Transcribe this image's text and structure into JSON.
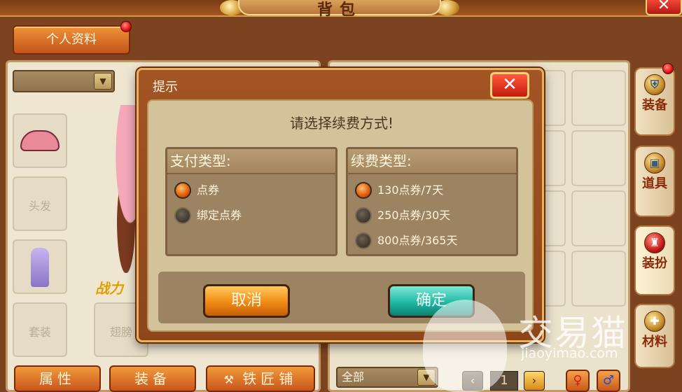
{
  "window": {
    "title": "背包",
    "close_glyph": "✕"
  },
  "left": {
    "tab_profile": "个人资料",
    "slots": {
      "hair": "头发",
      "suit": "套装",
      "wings": "翅膀"
    },
    "power_label": "战力",
    "buttons": {
      "attributes": "属性",
      "equipment": "装备",
      "blacksmith": "铁匠铺"
    }
  },
  "right": {
    "side_tabs": [
      {
        "label": "装备",
        "icon": "shield-icon"
      },
      {
        "label": "道具",
        "icon": "chest-icon"
      },
      {
        "label": "装扮",
        "icon": "outfit-icon"
      },
      {
        "label": "材料",
        "icon": "puzzle-icon"
      }
    ],
    "filter": "全部",
    "pager": {
      "prev": "‹",
      "page": "1",
      "next": "›"
    },
    "gender": {
      "female": "♀",
      "male": "♂"
    }
  },
  "dialog": {
    "title": "提示",
    "close_glyph": "✕",
    "prompt": "请选择续费方式!",
    "pay_type": {
      "title": "支付类型:",
      "options": [
        "点券",
        "绑定点券"
      ],
      "selected": 0
    },
    "renew_type": {
      "title": "续费类型:",
      "options": [
        "130点券/7天",
        "250点券/30天",
        "800点券/365天"
      ],
      "selected": 0
    },
    "cancel": "取消",
    "ok": "确定"
  },
  "watermark": {
    "name": "交易猫",
    "url": "jiaoyimao.com"
  },
  "colors": {
    "accent_orange": "#e4600c",
    "ok_teal": "#1fb8a2",
    "dialog_brown": "#a35524"
  }
}
